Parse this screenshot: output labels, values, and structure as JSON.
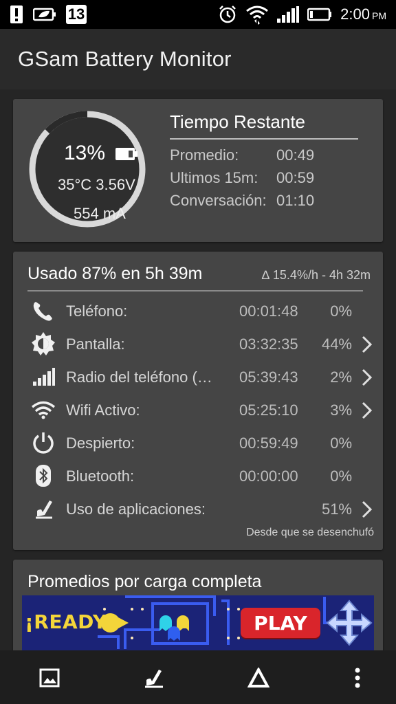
{
  "status_bar": {
    "notification_count": "13",
    "time": "2:00",
    "ampm": "PM",
    "icons": [
      "alert-icon",
      "leaf-battery-icon",
      "alarm-icon",
      "wifi-icon",
      "signal-icon",
      "battery-icon"
    ]
  },
  "app": {
    "title": "GSam Battery Monitor"
  },
  "summary": {
    "battery_percent_label": "13%",
    "battery_level": 0.13,
    "temperature_voltage": "35°C  3.56V",
    "current": "554 mA",
    "time_remaining": {
      "title": "Tiempo Restante",
      "rows": [
        {
          "label": "Promedio:",
          "value": "00:49"
        },
        {
          "label": "Ultimos 15m:",
          "value": "00:59"
        },
        {
          "label": "Conversación:",
          "value": "01:10"
        }
      ]
    }
  },
  "usage": {
    "title": "Usado 87% en 5h 39m",
    "rate": "∆ 15.4%/h - 4h 32m",
    "rows": [
      {
        "icon": "phone-icon",
        "name": "Teléfono:",
        "time": "00:01:48",
        "pct": "0%",
        "chevron": false
      },
      {
        "icon": "brightness-icon",
        "name": "Pantalla:",
        "time": "03:32:35",
        "pct": "44%",
        "chevron": true
      },
      {
        "icon": "signal-bars-icon",
        "name": "Radio del teléfono (…",
        "time": "05:39:43",
        "pct": "2%",
        "chevron": true
      },
      {
        "icon": "wifi-icon",
        "name": "Wifi Activo:",
        "time": "05:25:10",
        "pct": "3%",
        "chevron": true
      },
      {
        "icon": "power-icon",
        "name": "Despierto:",
        "time": "00:59:49",
        "pct": "0%",
        "chevron": false
      },
      {
        "icon": "bluetooth-icon",
        "name": "Bluetooth:",
        "time": "00:00:00",
        "pct": "0%",
        "chevron": false
      },
      {
        "icon": "app-usage-icon",
        "name": "Uso de aplicaciones:",
        "time": "",
        "pct": "51%",
        "chevron": true
      }
    ],
    "since": "Desde que se desenchufó"
  },
  "averages": {
    "title": "Promedios por carga completa"
  },
  "ad": {
    "ready_text": "¡READY!",
    "play_text": "PLAY"
  },
  "bottom_bar": {
    "icons": [
      "image-icon",
      "app-usage-icon",
      "delta-icon",
      "overflow-menu-icon"
    ]
  },
  "colors": {
    "card": "#454545",
    "background": "#252525",
    "gauge_ring": "#d9d9d9"
  }
}
